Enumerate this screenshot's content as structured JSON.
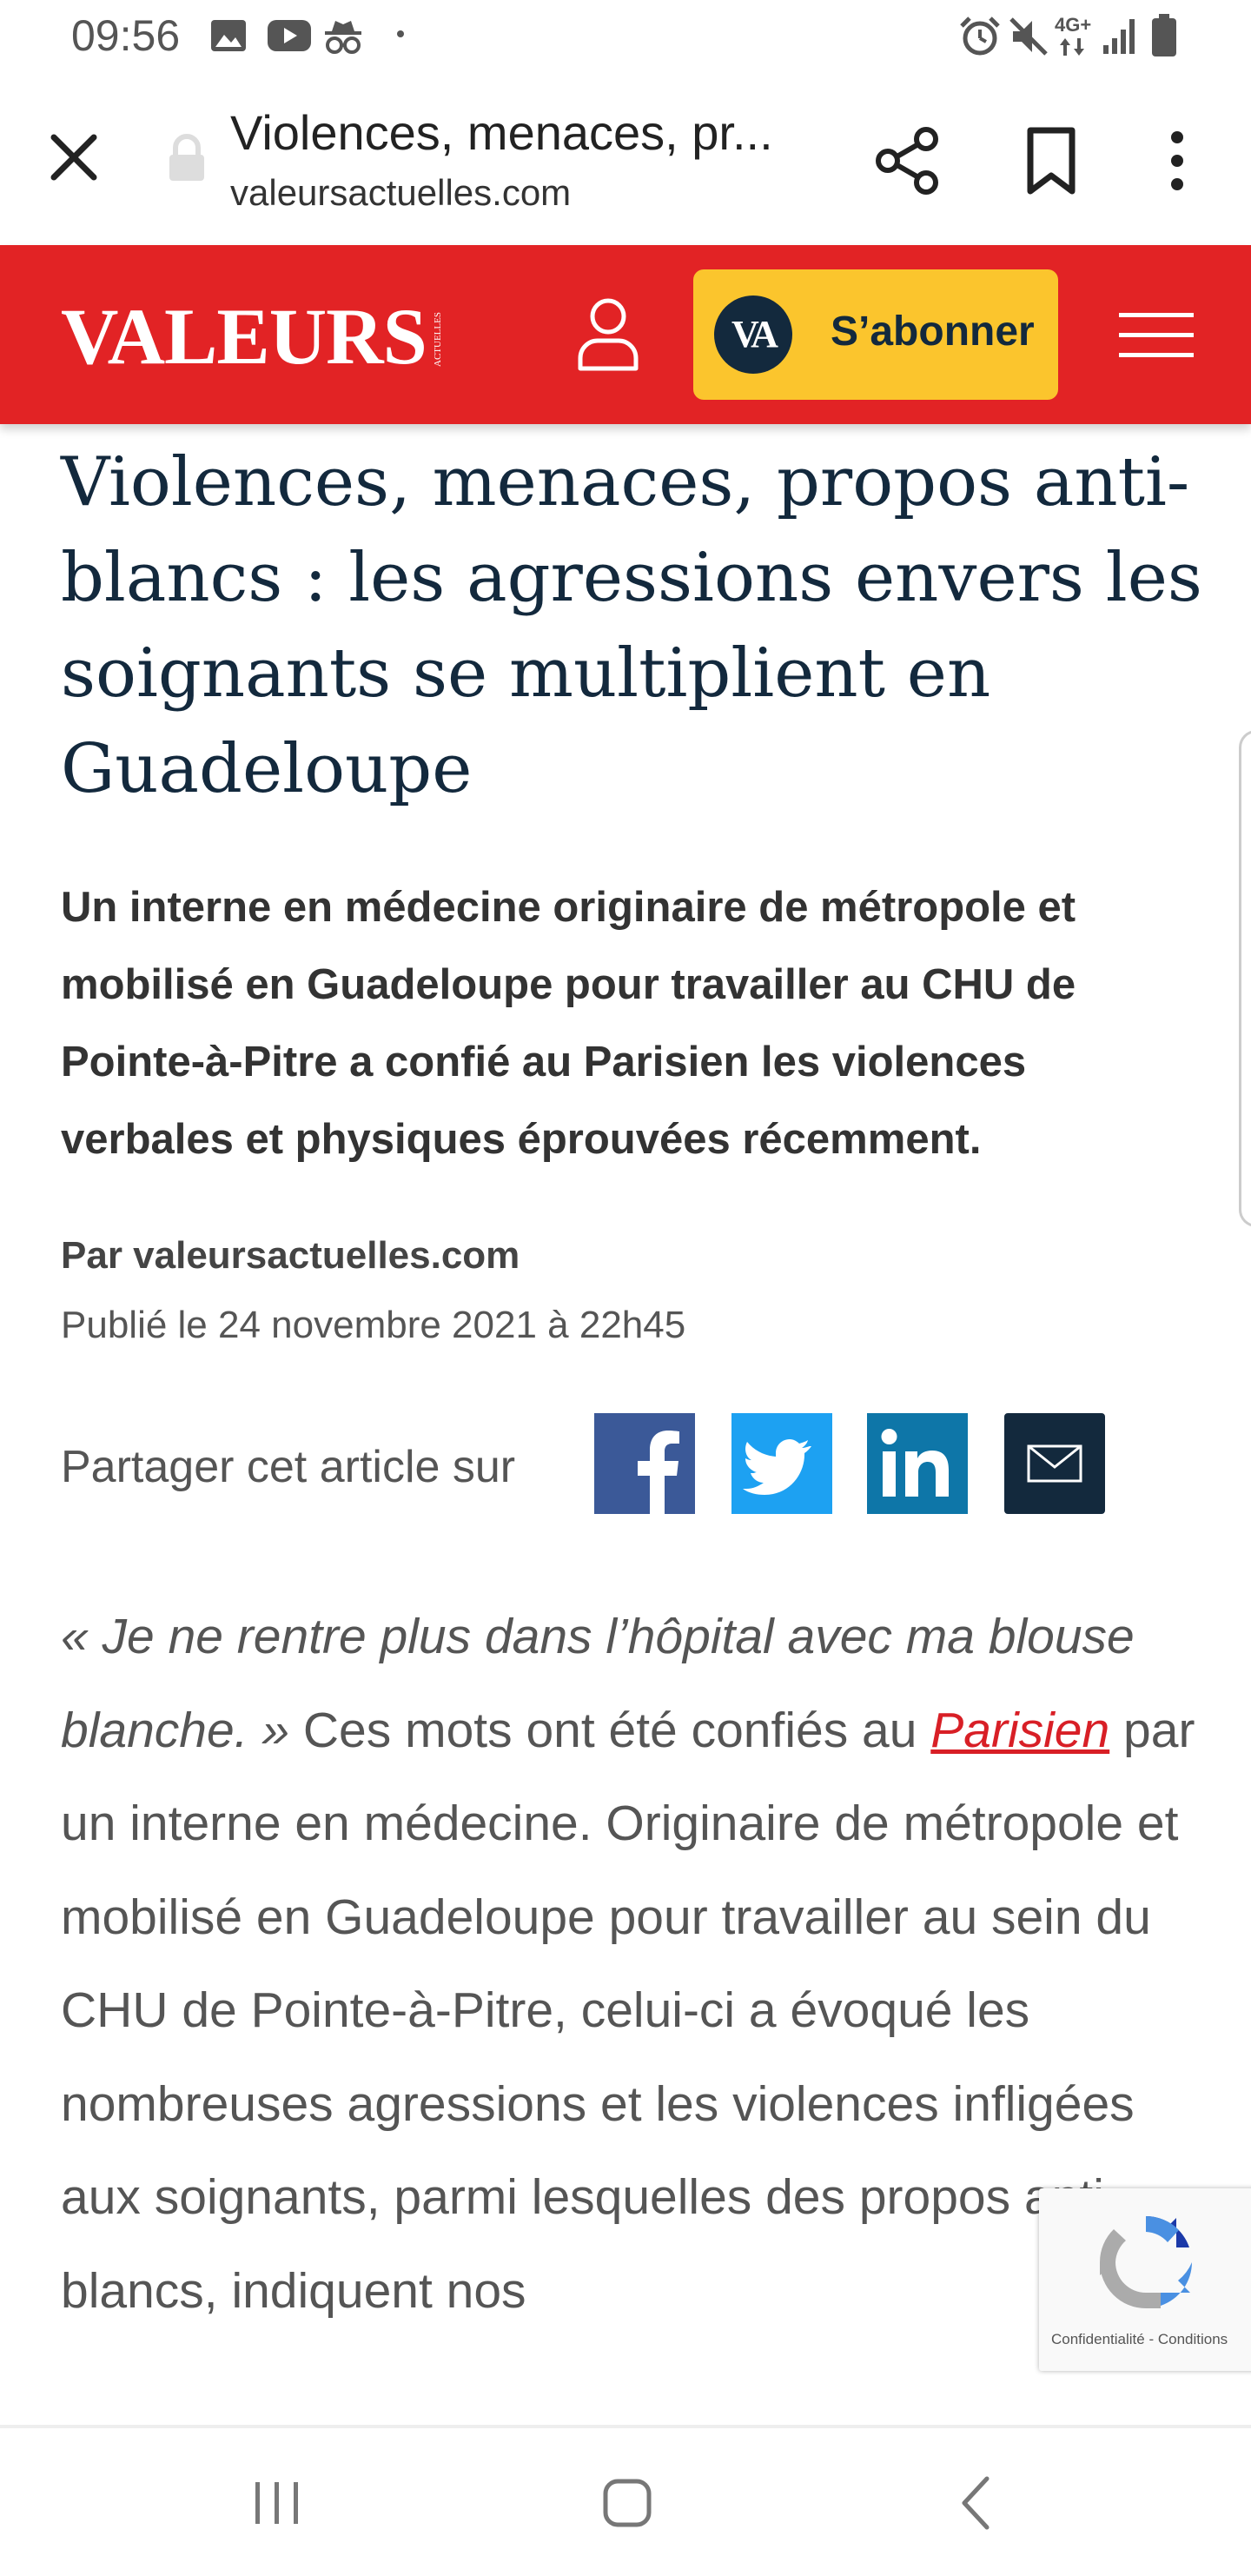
{
  "status_bar": {
    "time": "09:56",
    "left_icons": [
      "gallery-icon",
      "youtube-icon",
      "incognito-icon",
      "dot-icon"
    ],
    "right_icons": [
      "alarm-icon",
      "mute-icon",
      "network-4g-icon",
      "signal-icon",
      "battery-icon"
    ],
    "network": "4G+"
  },
  "browser": {
    "title": "Violences, menaces, pr...",
    "url": "valeursactuelles.com"
  },
  "site_header": {
    "logo": "VALEURS",
    "logo_sub": "ACTUELLES",
    "badge": "VA",
    "subscribe_label": "S’abonner",
    "brand_color": "#e22325",
    "button_color": "#fbc52d"
  },
  "article": {
    "headline": "Violences, menaces, propos anti-blancs : les agressions envers les soignants se multiplient en Guadeloupe",
    "lead": "Un interne en médecine originaire de métropole et mobilisé en Guadeloupe pour travailler au CHU de Pointe-à-Pitre a confié au Parisien les violences verbales et physiques éprouvées récemment.",
    "byline": "Par valeursactuelles.com",
    "published": "Publié le 24 novembre 2021 à 22h45",
    "share_label": "Partager cet article sur",
    "body": {
      "quote": "« Je ne rentre plus dans l’hôpital avec ma blouse blanche. »",
      "text1": " Ces mots ont été confiés au ",
      "link": "Parisien",
      "text2": " par un interne en médecine. Originaire de métropole et mobilisé en Guadeloupe pour travailler au sein du CHU de Pointe-à-Pitre, celui-ci a évoqué les nombreuses agressions et les violences infligées aux soignants, parmi lesquelles des propos anti-blancs, indiquent nos"
    }
  },
  "recaptcha": {
    "text": "Confidentialité - Conditions"
  }
}
